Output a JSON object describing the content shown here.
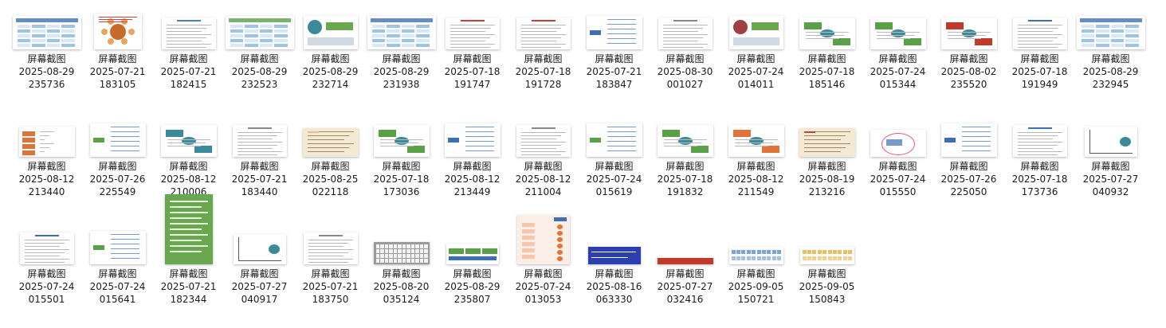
{
  "files": [
    {
      "name": "屏幕截图",
      "date": "2025-08-29",
      "time": "235736",
      "thumb": "table",
      "accent": "#3d6fb6"
    },
    {
      "name": "屏幕截图",
      "date": "2025-07-21",
      "time": "183105",
      "thumb": "circle",
      "accent": "#c86a2a"
    },
    {
      "name": "屏幕截图",
      "date": "2025-07-21",
      "time": "182415",
      "thumb": "doc",
      "accent": "#4a7fc0"
    },
    {
      "name": "屏幕截图",
      "date": "2025-08-29",
      "time": "232523",
      "thumb": "table",
      "accent": "#5aa047"
    },
    {
      "name": "屏幕截图",
      "date": "2025-08-29",
      "time": "232714",
      "thumb": "photo",
      "accent": "#3a8a9a"
    },
    {
      "name": "屏幕截图",
      "date": "2025-08-29",
      "time": "231938",
      "thumb": "table",
      "accent": "#3d6fb6"
    },
    {
      "name": "屏幕截图",
      "date": "2025-07-18",
      "time": "191747",
      "thumb": "doc",
      "accent": "#c04040"
    },
    {
      "name": "屏幕截图",
      "date": "2025-07-18",
      "time": "191728",
      "thumb": "doc",
      "accent": "#c04040"
    },
    {
      "name": "屏幕截图",
      "date": "2025-07-21",
      "time": "183847",
      "thumb": "mindmap",
      "accent": "#3d6fb6"
    },
    {
      "name": "屏幕截图",
      "date": "2025-08-30",
      "time": "001027",
      "thumb": "doc",
      "accent": "#888888"
    },
    {
      "name": "屏幕截图",
      "date": "2025-07-24",
      "time": "014011",
      "thumb": "photo",
      "accent": "#a04040"
    },
    {
      "name": "屏幕截图",
      "date": "2025-07-18",
      "time": "185146",
      "thumb": "flow",
      "accent": "#5aa047"
    },
    {
      "name": "屏幕截图",
      "date": "2025-07-24",
      "time": "015344",
      "thumb": "flow",
      "accent": "#5aa047"
    },
    {
      "name": "屏幕截图",
      "date": "2025-08-02",
      "time": "235520",
      "thumb": "flow",
      "accent": "#c0392b"
    },
    {
      "name": "屏幕截图",
      "date": "2025-07-18",
      "time": "191949",
      "thumb": "doc",
      "accent": "#3d6fb6"
    },
    {
      "name": "屏幕截图",
      "date": "2025-08-29",
      "time": "232945",
      "thumb": "table",
      "accent": "#3d6fb6"
    },
    {
      "name": "屏幕截图",
      "date": "2025-08-12",
      "time": "213440",
      "thumb": "orange",
      "accent": "#e0733a"
    },
    {
      "name": "屏幕截图",
      "date": "2025-07-26",
      "time": "225549",
      "thumb": "mindmap",
      "accent": "#5aa047"
    },
    {
      "name": "屏幕截图",
      "date": "2025-08-12",
      "time": "210006",
      "thumb": "flow",
      "accent": "#3a8a9a"
    },
    {
      "name": "屏幕截图",
      "date": "2025-07-21",
      "time": "183440",
      "thumb": "doc",
      "accent": "#888888"
    },
    {
      "name": "屏幕截图",
      "date": "2025-08-25",
      "time": "022118",
      "thumb": "beige",
      "accent": "#d8c49a"
    },
    {
      "name": "屏幕截图",
      "date": "2025-07-18",
      "time": "173036",
      "thumb": "flow",
      "accent": "#5aa047"
    },
    {
      "name": "屏幕截图",
      "date": "2025-08-12",
      "time": "213449",
      "thumb": "mindmap",
      "accent": "#3d6fb6"
    },
    {
      "name": "屏幕截图",
      "date": "2025-08-12",
      "time": "211004",
      "thumb": "doc",
      "accent": "#888888"
    },
    {
      "name": "屏幕截图",
      "date": "2025-07-24",
      "time": "015619",
      "thumb": "mindmap",
      "accent": "#5aa047"
    },
    {
      "name": "屏幕截图",
      "date": "2025-07-18",
      "time": "191832",
      "thumb": "flow",
      "accent": "#5aa047"
    },
    {
      "name": "屏幕截图",
      "date": "2025-08-12",
      "time": "211549",
      "thumb": "flow",
      "accent": "#e0733a"
    },
    {
      "name": "屏幕截图",
      "date": "2025-08-19",
      "time": "213216",
      "thumb": "beige",
      "accent": "#c04040"
    },
    {
      "name": "屏幕截图",
      "date": "2025-07-24",
      "time": "015550",
      "thumb": "venn",
      "accent": "#3d6fb6"
    },
    {
      "name": "屏幕截图",
      "date": "2025-07-26",
      "time": "225050",
      "thumb": "mindmap",
      "accent": "#3d6fb6"
    },
    {
      "name": "屏幕截图",
      "date": "2025-07-18",
      "time": "173736",
      "thumb": "doc",
      "accent": "#3d6fb6"
    },
    {
      "name": "屏幕截图",
      "date": "2025-07-27",
      "time": "040932",
      "thumb": "graph",
      "accent": "#3a8a9a"
    },
    {
      "name": "屏幕截图",
      "date": "2025-07-24",
      "time": "015501",
      "thumb": "doc",
      "accent": "#3d6fb6"
    },
    {
      "name": "屏幕截图",
      "date": "2025-07-24",
      "time": "015641",
      "thumb": "mindmap",
      "accent": "#5aa047"
    },
    {
      "name": "屏幕截图",
      "date": "2025-07-21",
      "time": "182344",
      "thumb": "green",
      "accent": "#6aa84f"
    },
    {
      "name": "屏幕截图",
      "date": "2025-07-27",
      "time": "040917",
      "thumb": "graph",
      "accent": "#3a8a9a"
    },
    {
      "name": "屏幕截图",
      "date": "2025-07-21",
      "time": "183750",
      "thumb": "doc",
      "accent": "#888888"
    },
    {
      "name": "屏幕截图",
      "date": "2025-08-20",
      "time": "035124",
      "thumb": "keyboard",
      "accent": "#777777"
    },
    {
      "name": "屏幕截图",
      "date": "2025-08-29",
      "time": "235807",
      "thumb": "greenbar",
      "accent": "#5aa047"
    },
    {
      "name": "屏幕截图",
      "date": "2025-07-24",
      "time": "013053",
      "thumb": "tall",
      "accent": "#e0733a"
    },
    {
      "name": "屏幕截图",
      "date": "2025-08-16",
      "time": "063330",
      "thumb": "bluebar",
      "accent": "#2b3fb0"
    },
    {
      "name": "屏幕截图",
      "date": "2025-07-27",
      "time": "032416",
      "thumb": "redbar",
      "accent": "#c0392b"
    },
    {
      "name": "屏幕截图",
      "date": "2025-09-05",
      "time": "150721",
      "thumb": "chips",
      "accent": "#7aa6d6"
    },
    {
      "name": "屏幕截图",
      "date": "2025-09-05",
      "time": "150843",
      "thumb": "chips",
      "accent": "#e8c060"
    }
  ]
}
